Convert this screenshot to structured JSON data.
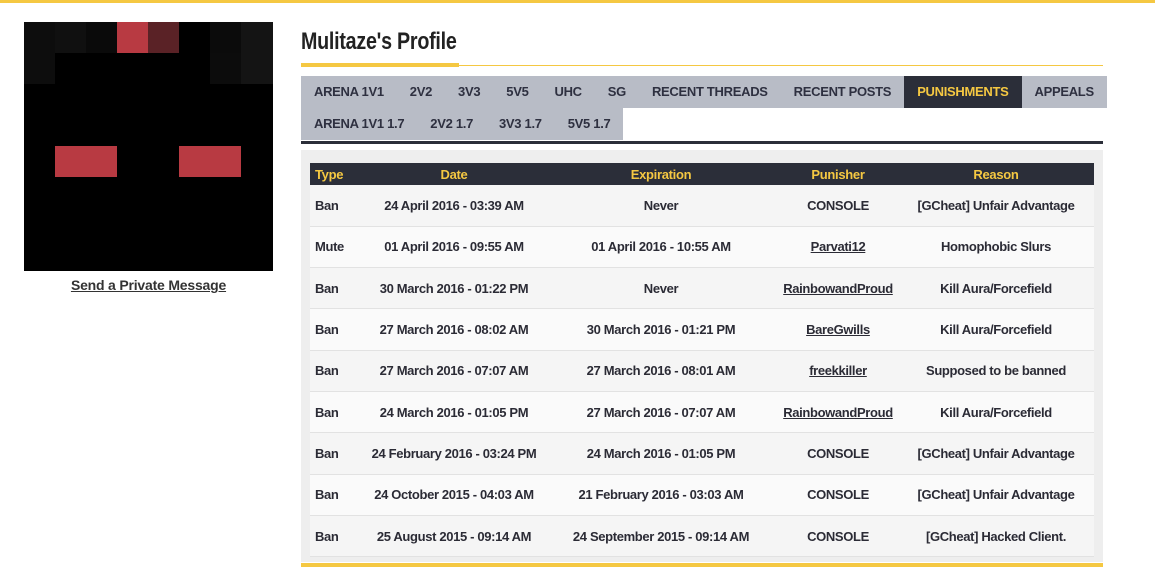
{
  "profile": {
    "title": "Mulitaze's Profile",
    "send_pm_label": "Send a Private Message"
  },
  "tabs": {
    "row1": [
      "ARENA 1V1",
      "2V2",
      "3V3",
      "5V5",
      "UHC",
      "SG",
      "RECENT THREADS",
      "RECENT POSTS",
      "PUNISHMENTS",
      "APPEALS"
    ],
    "row2": [
      "ARENA 1V1 1.7",
      "2V2 1.7",
      "3V3 1.7",
      "5V5 1.7"
    ],
    "active": "PUNISHMENTS"
  },
  "punishments": {
    "columns": [
      "Type",
      "Date",
      "Expiration",
      "Punisher",
      "Reason"
    ],
    "rows": [
      {
        "type": "Ban",
        "date": "24 April 2016 - 03:39 AM",
        "expiration": "Never",
        "punisher": "CONSOLE",
        "punisher_link": false,
        "reason": "[GCheat] Unfair Advantage"
      },
      {
        "type": "Mute",
        "date": "01 April 2016 - 09:55 AM",
        "expiration": "01 April 2016 - 10:55 AM",
        "punisher": "Parvati12",
        "punisher_link": true,
        "reason": "Homophobic Slurs"
      },
      {
        "type": "Ban",
        "date": "30 March 2016 - 01:22 PM",
        "expiration": "Never",
        "punisher": "RainbowandProud",
        "punisher_link": true,
        "reason": "Kill Aura/Forcefield"
      },
      {
        "type": "Ban",
        "date": "27 March 2016 - 08:02 AM",
        "expiration": "30 March 2016 - 01:21 PM",
        "punisher": "BareGwills",
        "punisher_link": true,
        "reason": "Kill Aura/Forcefield"
      },
      {
        "type": "Ban",
        "date": "27 March 2016 - 07:07 AM",
        "expiration": "27 March 2016 - 08:01 AM",
        "punisher": "freekkiller",
        "punisher_link": true,
        "reason": "Supposed to be banned"
      },
      {
        "type": "Ban",
        "date": "24 March 2016 - 01:05 PM",
        "expiration": "27 March 2016 - 07:07 AM",
        "punisher": "RainbowandProud",
        "punisher_link": true,
        "reason": "Kill Aura/Forcefield"
      },
      {
        "type": "Ban",
        "date": "24 February 2016 - 03:24 PM",
        "expiration": "24 March 2016 - 01:05 PM",
        "punisher": "CONSOLE",
        "punisher_link": false,
        "reason": "[GCheat] Unfair Advantage"
      },
      {
        "type": "Ban",
        "date": "24 October 2015 - 04:03 AM",
        "expiration": "21 February 2016 - 03:03 AM",
        "punisher": "CONSOLE",
        "punisher_link": false,
        "reason": "[GCheat] Unfair Advantage"
      },
      {
        "type": "Ban",
        "date": "25 August 2015 - 09:14 AM",
        "expiration": "24 September 2015 - 09:14 AM",
        "punisher": "CONSOLE",
        "punisher_link": false,
        "reason": "[GCheat] Hacked Client."
      }
    ]
  },
  "colors": {
    "accent": "#f5c842",
    "dark": "#2b2e39",
    "tab_bg": "#b8bcc6",
    "avatar_red": "#b83a42"
  }
}
